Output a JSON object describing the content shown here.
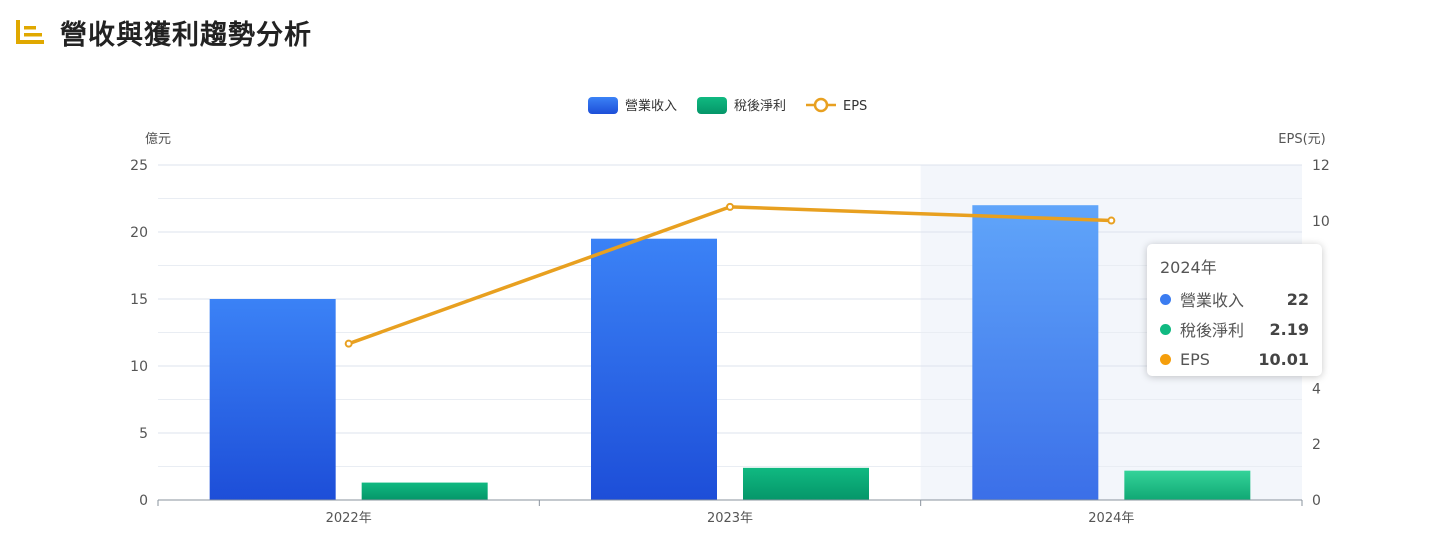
{
  "header": {
    "title": "營收與獲利趨勢分析",
    "icon": "bar-list-icon",
    "icon_color": "#e0a800"
  },
  "chart_data": {
    "type": "bar",
    "categories": [
      "2022年",
      "2023年",
      "2024年"
    ],
    "series": [
      {
        "name": "營業收入",
        "kind": "bar",
        "axis": "left",
        "values": [
          15,
          19.5,
          22
        ],
        "color": "#3b7cf0"
      },
      {
        "name": "稅後淨利",
        "kind": "bar",
        "axis": "left",
        "values": [
          1.3,
          2.4,
          2.19
        ],
        "color": "#10a874"
      },
      {
        "name": "EPS",
        "kind": "line",
        "axis": "right",
        "values": [
          5.6,
          10.5,
          10.01
        ],
        "color": "#e8a020"
      }
    ],
    "left_axis": {
      "label": "億元",
      "ylim": [
        0,
        25
      ],
      "ticks": [
        "0",
        "5",
        "10",
        "15",
        "20",
        "25"
      ]
    },
    "right_axis": {
      "label": "EPS(元)",
      "ylim": [
        0,
        12
      ],
      "ticks": [
        "0",
        "2",
        "4",
        "10",
        "12"
      ]
    },
    "legend_position": "top-center",
    "grid": true,
    "highlighted_category": "2024年"
  },
  "tooltip": {
    "title": "2024年",
    "rows": [
      {
        "label": "營業收入",
        "value": "22",
        "color": "#3b7cf0"
      },
      {
        "label": "稅後淨利",
        "value": "2.19",
        "color": "#10b981"
      },
      {
        "label": "EPS",
        "value": "10.01",
        "color": "#f59e0b"
      }
    ]
  }
}
